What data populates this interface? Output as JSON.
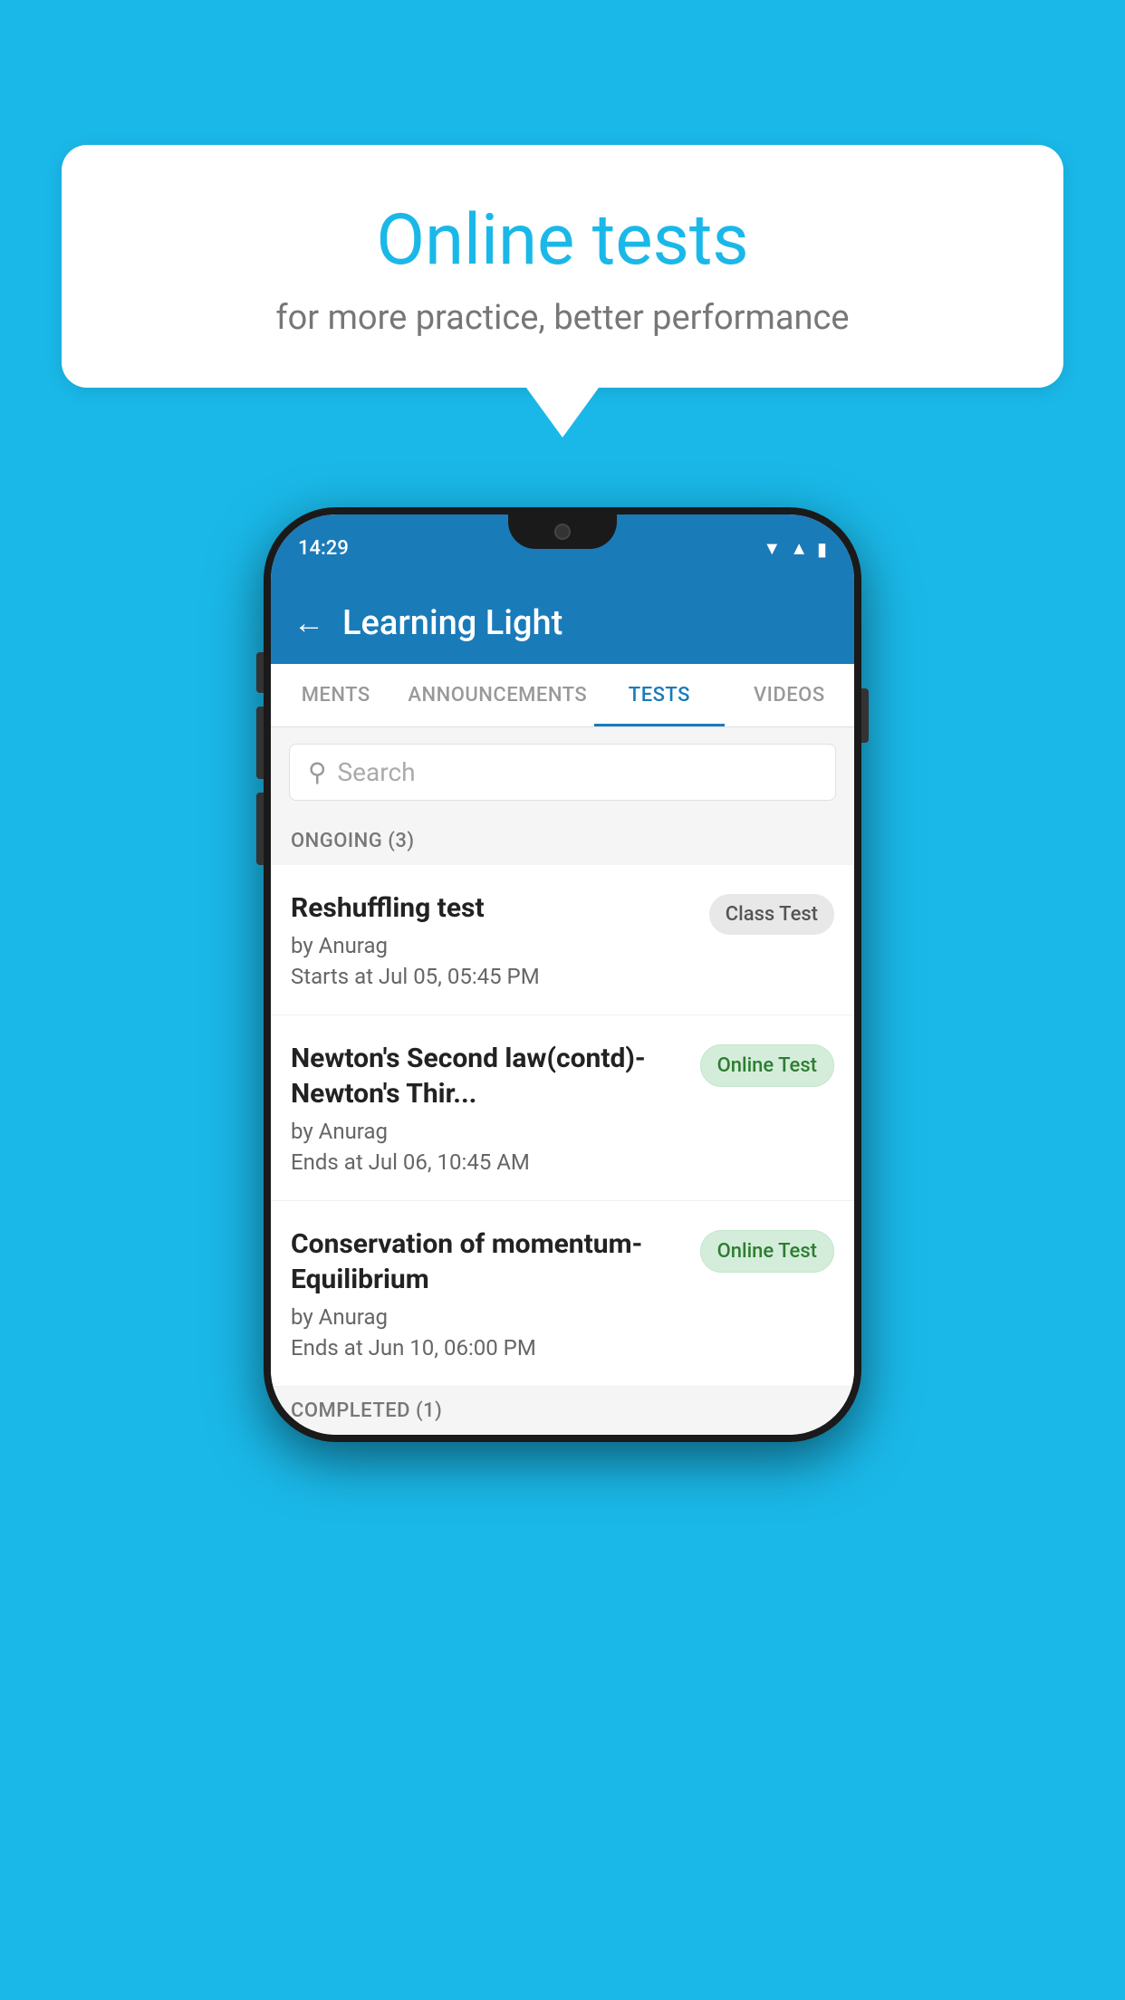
{
  "background_color": "#1ab8e8",
  "speech_bubble": {
    "title": "Online tests",
    "subtitle": "for more practice, better performance"
  },
  "phone": {
    "status_bar": {
      "time": "14:29",
      "icons": [
        "wifi",
        "signal",
        "battery"
      ]
    },
    "toolbar": {
      "title": "Learning Light",
      "back_label": "←"
    },
    "tabs": [
      {
        "label": "MENTS",
        "active": false
      },
      {
        "label": "ANNOUNCEMENTS",
        "active": false
      },
      {
        "label": "TESTS",
        "active": true
      },
      {
        "label": "VIDEOS",
        "active": false
      }
    ],
    "search": {
      "placeholder": "Search"
    },
    "ongoing_section": {
      "label": "ONGOING (3)"
    },
    "tests": [
      {
        "title": "Reshuffling test",
        "author": "by Anurag",
        "time": "Starts at  Jul 05, 05:45 PM",
        "badge": "Class Test",
        "badge_type": "class"
      },
      {
        "title": "Newton's Second law(contd)-Newton's Thir...",
        "author": "by Anurag",
        "time": "Ends at  Jul 06, 10:45 AM",
        "badge": "Online Test",
        "badge_type": "online"
      },
      {
        "title": "Conservation of momentum-Equilibrium",
        "author": "by Anurag",
        "time": "Ends at  Jun 10, 06:00 PM",
        "badge": "Online Test",
        "badge_type": "online"
      }
    ],
    "completed_section": {
      "label": "COMPLETED (1)"
    }
  }
}
